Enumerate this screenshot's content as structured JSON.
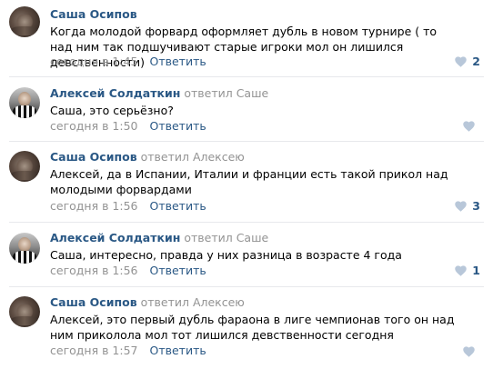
{
  "comments": [
    {
      "author": "Саша Осипов",
      "reply_to": "",
      "text": "Когда молодой форвард оформляет дубль в новом турнире ( то над ним так подшучивают старые игроки мол он лишился девственности)",
      "time": "сегодня в 1:45",
      "reply_label": "Ответить",
      "likes": "2"
    },
    {
      "author": "Алексей Солдаткин",
      "reply_to": "ответил Саше",
      "text": "Саша, это серьёзно?",
      "time": "сегодня в 1:50",
      "reply_label": "Ответить",
      "likes": ""
    },
    {
      "author": "Саша Осипов",
      "reply_to": "ответил Алексею",
      "text": "Алексей, да в Испании, Италии и франции есть такой прикол над молодыми форвардами",
      "time": "сегодня в 1:56",
      "reply_label": "Ответить",
      "likes": "3"
    },
    {
      "author": "Алексей Солдаткин",
      "reply_to": "ответил Саше",
      "text": "Саша, интересно, правда у них разница в возрасте 4 года",
      "time": "сегодня в 1:56",
      "reply_label": "Ответить",
      "likes": "1"
    },
    {
      "author": "Саша Осипов",
      "reply_to": "ответил Алексею",
      "text": "Алексей, это первый дубль фараона в лиге чемпионав того он над ним приколола мол тот лишился девственности сегодня",
      "time": "сегодня в 1:57",
      "reply_label": "Ответить",
      "likes": ""
    }
  ],
  "colors": {
    "link": "#2a5885",
    "muted": "#939393",
    "heart": "#b8c7d9",
    "divider": "#e7e8ec"
  },
  "icons": {
    "like": "heart-icon"
  }
}
